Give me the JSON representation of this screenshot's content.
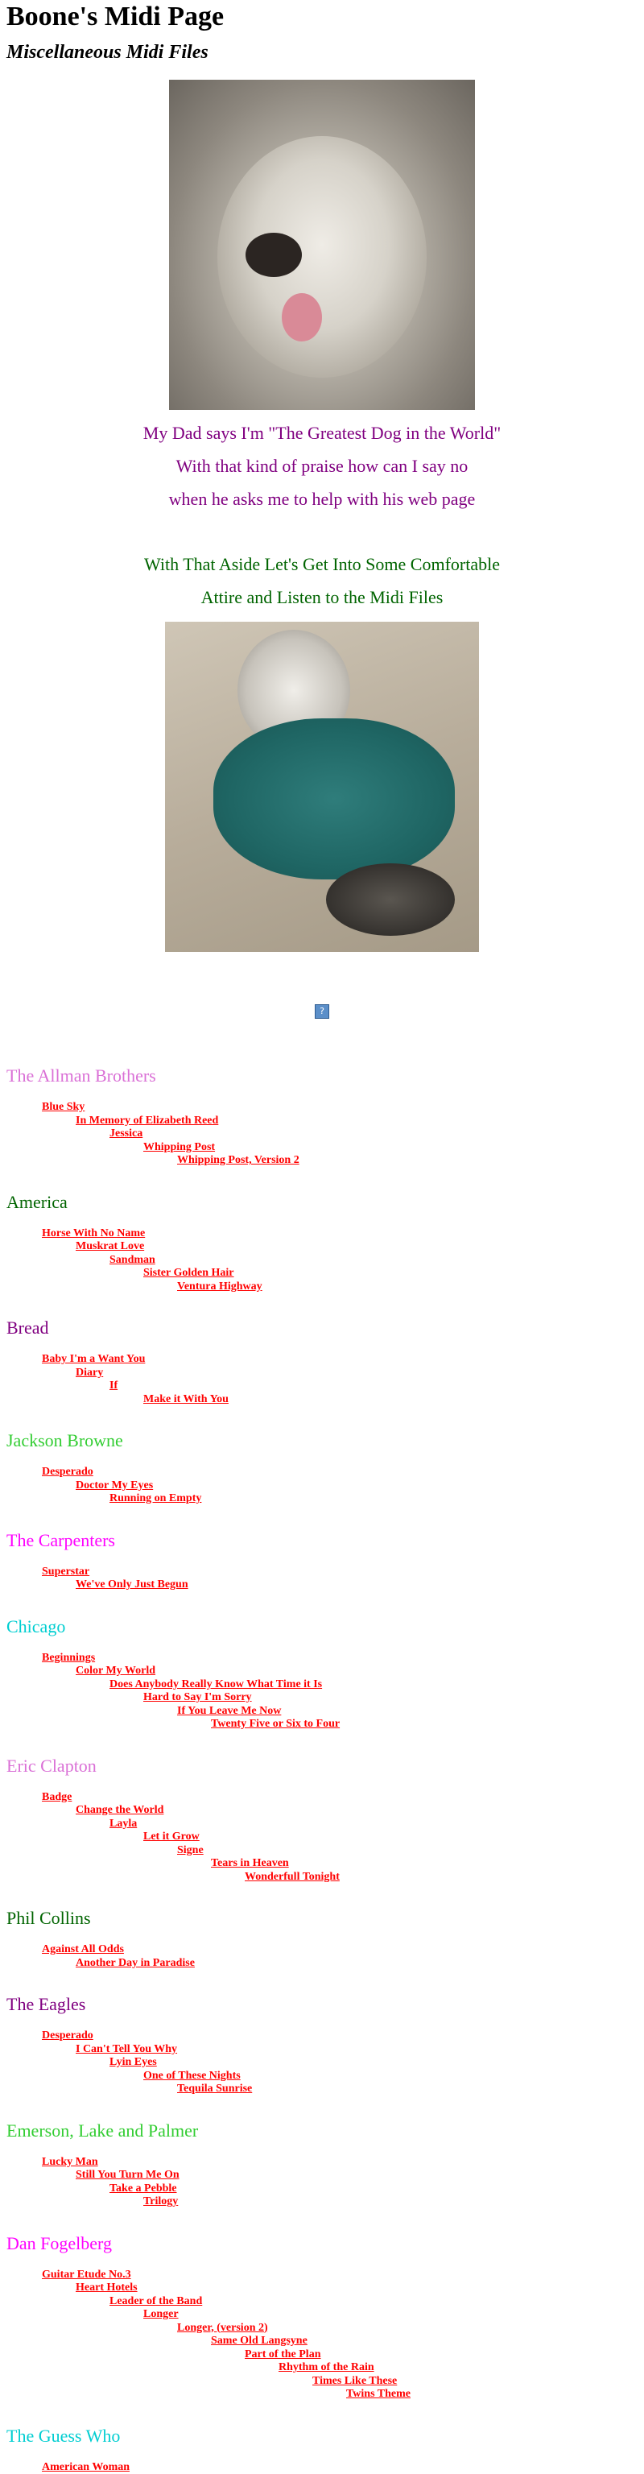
{
  "page": {
    "title": "Boone's Midi Page",
    "subtitle": "Miscellaneous Midi Files"
  },
  "caption1": [
    "My Dad says I'm \"The Greatest Dog in the World\"",
    "With that kind of praise how can I say no",
    "when he asks me to help with his web page"
  ],
  "caption2": [
    "With That Aside Let's Get Into Some Comfortable",
    "Attire and Listen to the Midi Files"
  ],
  "colors": {
    "allman": "#da70d6",
    "america": "#006400",
    "bread": "#800080",
    "browne": "#32cd32",
    "carpenters": "#ff00ff",
    "chicago": "#00ced1",
    "clapton": "#da70d6",
    "collins": "#006400",
    "eagles": "#800080",
    "elp": "#32cd32",
    "fogelberg": "#ff00ff",
    "guesswho": "#00ced1",
    "link": "#ff0000"
  },
  "icons": {
    "broken_image": "broken-image-icon"
  },
  "sections": [
    {
      "artist": "The Allman Brothers",
      "color_key": "allman",
      "songs": [
        "Blue Sky",
        "In Memory of Elizabeth Reed",
        "Jessica",
        "Whipping Post",
        "Whipping Post, Version 2"
      ]
    },
    {
      "artist": "America",
      "color_key": "america",
      "songs": [
        "Horse With No Name",
        "Muskrat Love",
        "Sandman",
        "Sister Golden Hair",
        "Ventura Highway"
      ]
    },
    {
      "artist": "Bread",
      "color_key": "bread",
      "songs": [
        "Baby I'm a Want You",
        "Diary",
        "If",
        "Make it With You"
      ]
    },
    {
      "artist": "Jackson Browne",
      "color_key": "browne",
      "songs": [
        "Desperado",
        "Doctor My Eyes",
        "Running on Empty"
      ]
    },
    {
      "artist": "The Carpenters",
      "color_key": "carpenters",
      "songs": [
        "Superstar",
        "We've Only Just Begun"
      ]
    },
    {
      "artist": "Chicago",
      "color_key": "chicago",
      "songs": [
        "Beginnings",
        "Color My World",
        "Does Anybody Really Know What Time it Is",
        "Hard to Say I'm Sorry",
        "If You Leave Me Now",
        "Twenty Five or Six to Four"
      ]
    },
    {
      "artist": "Eric Clapton",
      "color_key": "clapton",
      "songs": [
        "Badge",
        "Change the World",
        "Layla",
        "Let it Grow",
        "Signe",
        "Tears in Heaven",
        "Wonderfull Tonight"
      ]
    },
    {
      "artist": "Phil Collins",
      "color_key": "collins",
      "songs": [
        "Against All Odds",
        "Another Day in Paradise"
      ]
    },
    {
      "artist": "The Eagles",
      "color_key": "eagles",
      "songs": [
        "Desperado",
        "I Can't Tell You Why",
        "Lyin Eyes",
        "One of These Nights",
        "Tequila Sunrise"
      ]
    },
    {
      "artist": "Emerson, Lake and Palmer",
      "color_key": "elp",
      "songs": [
        "Lucky Man",
        "Still You Turn Me On",
        "Take a Pebble",
        "Trilogy"
      ]
    },
    {
      "artist": "Dan Fogelberg",
      "color_key": "fogelberg",
      "songs": [
        "Guitar Etude No.3",
        "Heart Hotels",
        "Leader of the Band",
        "Longer",
        "Longer, (version 2)",
        "Same Old Langsyne",
        "Part of the Plan",
        "Rhythm of the Rain",
        "Times Like These",
        "Twins Theme"
      ]
    },
    {
      "artist": "The Guess Who",
      "color_key": "guesswho",
      "songs": [
        "American Woman"
      ]
    }
  ]
}
